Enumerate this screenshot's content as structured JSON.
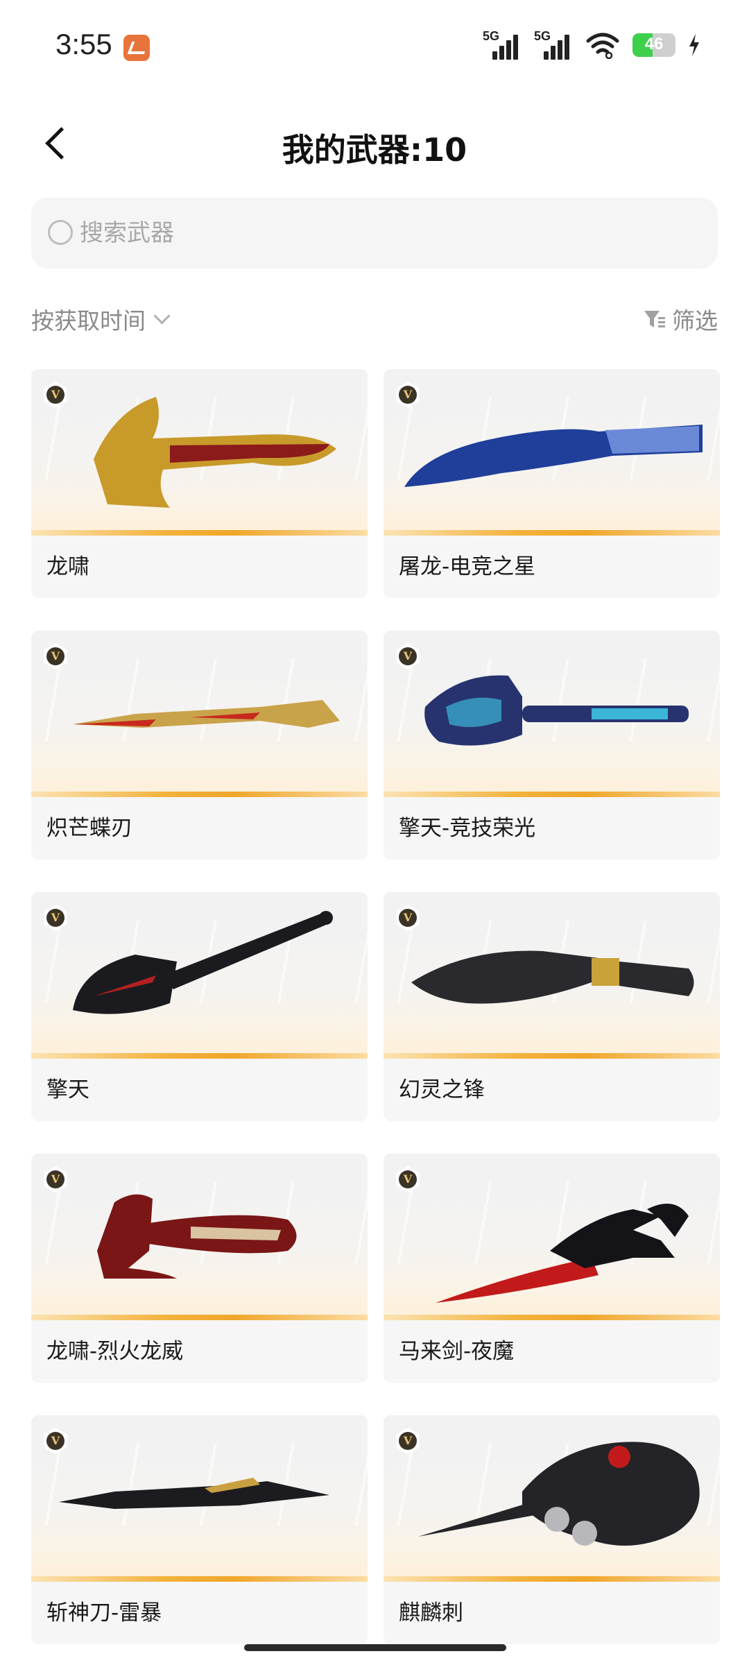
{
  "status_bar": {
    "time": "3:55",
    "signal_1_label": "5G",
    "signal_2_label": "5G",
    "battery_percent": "46",
    "battery_level": 0.46,
    "icons": [
      "app-icon",
      "signal-icon",
      "signal-icon",
      "wifi-icon",
      "battery-icon",
      "charging-bolt-icon"
    ]
  },
  "header": {
    "title": "我的武器:10",
    "back_icon": "chevron-left-icon"
  },
  "search": {
    "placeholder": "搜索武器",
    "value": "",
    "icon": "search-icon"
  },
  "sort": {
    "label": "按获取时间",
    "icon": "chevron-down-icon"
  },
  "filter": {
    "label": "筛选",
    "icon": "filter-icon"
  },
  "badge_letter": "V",
  "weapons": [
    {
      "name": "龙啸",
      "colors": [
        "#c89a2a",
        "#8b1a1a"
      ]
    },
    {
      "name": "屠龙-电竞之星",
      "colors": [
        "#1f3f9a",
        "#6a8ad8"
      ]
    },
    {
      "name": "炽芒蝶刃",
      "colors": [
        "#c9a34a",
        "#c8281e"
      ]
    },
    {
      "name": "擎天-竞技荣光",
      "colors": [
        "#27336e",
        "#3cb6d8"
      ]
    },
    {
      "name": "擎天",
      "colors": [
        "#1b1b1f",
        "#b52020"
      ]
    },
    {
      "name": "幻灵之锋",
      "colors": [
        "#2a2a2e",
        "#c9a23a"
      ]
    },
    {
      "name": "龙啸-烈火龙威",
      "colors": [
        "#7a1616",
        "#d9c3a0"
      ]
    },
    {
      "name": "马来剑-夜魔",
      "colors": [
        "#141418",
        "#c21a1a"
      ]
    },
    {
      "name": "斩神刀-雷暴",
      "colors": [
        "#1c1c20",
        "#c8a040"
      ]
    },
    {
      "name": "麒麟刺",
      "colors": [
        "#242428",
        "#b8b8bc"
      ]
    }
  ]
}
